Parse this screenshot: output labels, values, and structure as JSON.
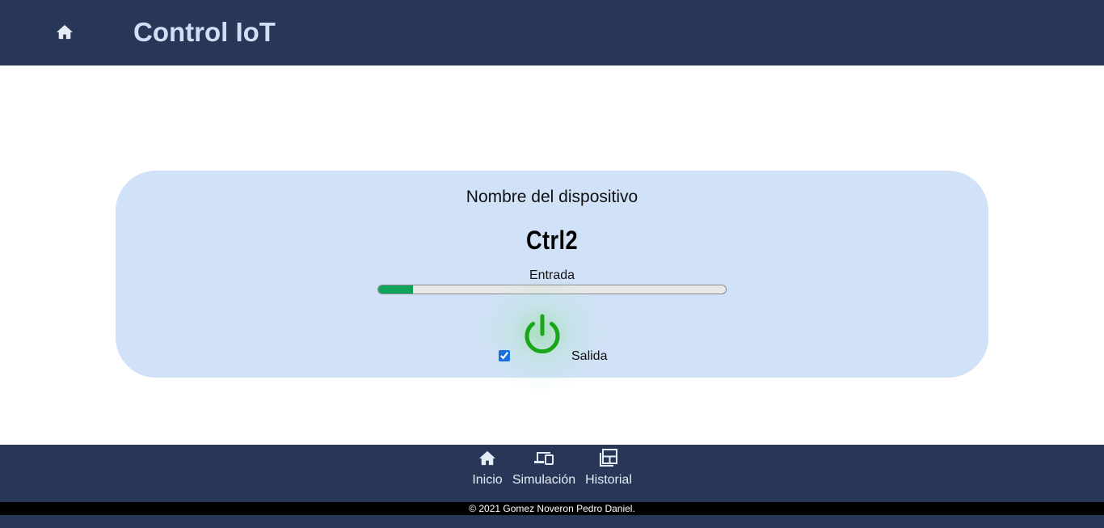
{
  "header": {
    "home_icon": "home-icon",
    "title": "Control IoT",
    "colors": {
      "background": "#283757",
      "title": "#cfe0f6"
    }
  },
  "device": {
    "caption": "Nombre del dispositivo",
    "name": "Ctrl2",
    "input": {
      "label": "Entrada",
      "level": 0.1,
      "color": "#0ea35a"
    },
    "output": {
      "label": "Salida",
      "checked": true,
      "power_icon": "power-icon",
      "power_color": "#1aa61a"
    },
    "card_color": "#d1e1f8"
  },
  "bottom_nav": {
    "items": [
      {
        "icon": "home-icon",
        "label": "Inicio"
      },
      {
        "icon": "devices-icon",
        "label": "Simulación"
      },
      {
        "icon": "history-icon",
        "label": "Historial"
      }
    ]
  },
  "footer": {
    "text": "© 2021 Gomez Noveron Pedro Daniel."
  }
}
